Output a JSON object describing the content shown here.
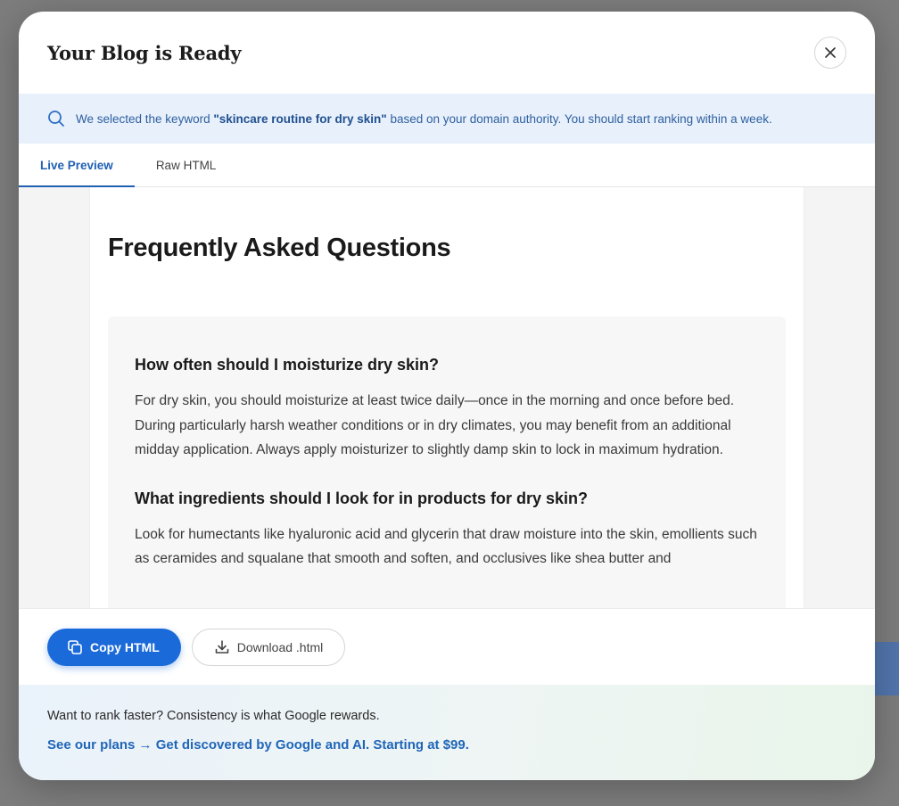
{
  "modal": {
    "title": "Your Blog is Ready",
    "close_icon": "close-icon"
  },
  "info_bar": {
    "icon": "search-icon",
    "prefix": "We selected the keyword ",
    "keyword": "\"skincare routine for dry skin\"",
    "suffix": " based on your domain authority. You should start ranking within a week."
  },
  "tabs": [
    {
      "label": "Live Preview",
      "active": true
    },
    {
      "label": "Raw HTML",
      "active": false
    }
  ],
  "preview": {
    "heading": "Frequently Asked Questions",
    "faqs": [
      {
        "question": "How often should I moisturize dry skin?",
        "answer": "For dry skin, you should moisturize at least twice daily—once in the morning and once before bed. During particularly harsh weather conditions or in dry climates, you may benefit from an additional midday application. Always apply moisturizer to slightly damp skin to lock in maximum hydration."
      },
      {
        "question": "What ingredients should I look for in products for dry skin?",
        "answer": "Look for humectants like hyaluronic acid and glycerin that draw moisture into the skin, emollients such as ceramides and squalane that smooth and soften, and occlusives like shea butter and"
      }
    ]
  },
  "actions": {
    "copy_label": "Copy HTML",
    "copy_icon": "copy-icon",
    "download_label": "Download .html",
    "download_icon": "download-icon"
  },
  "footer": {
    "text": "Want to rank faster? Consistency is what Google rewards.",
    "link": "See our plans → Get discovered by Google and AI. Starting at $99."
  },
  "colors": {
    "accent": "#1b6ad9",
    "info_bg": "#e8f0fc",
    "link": "#2066b8"
  }
}
